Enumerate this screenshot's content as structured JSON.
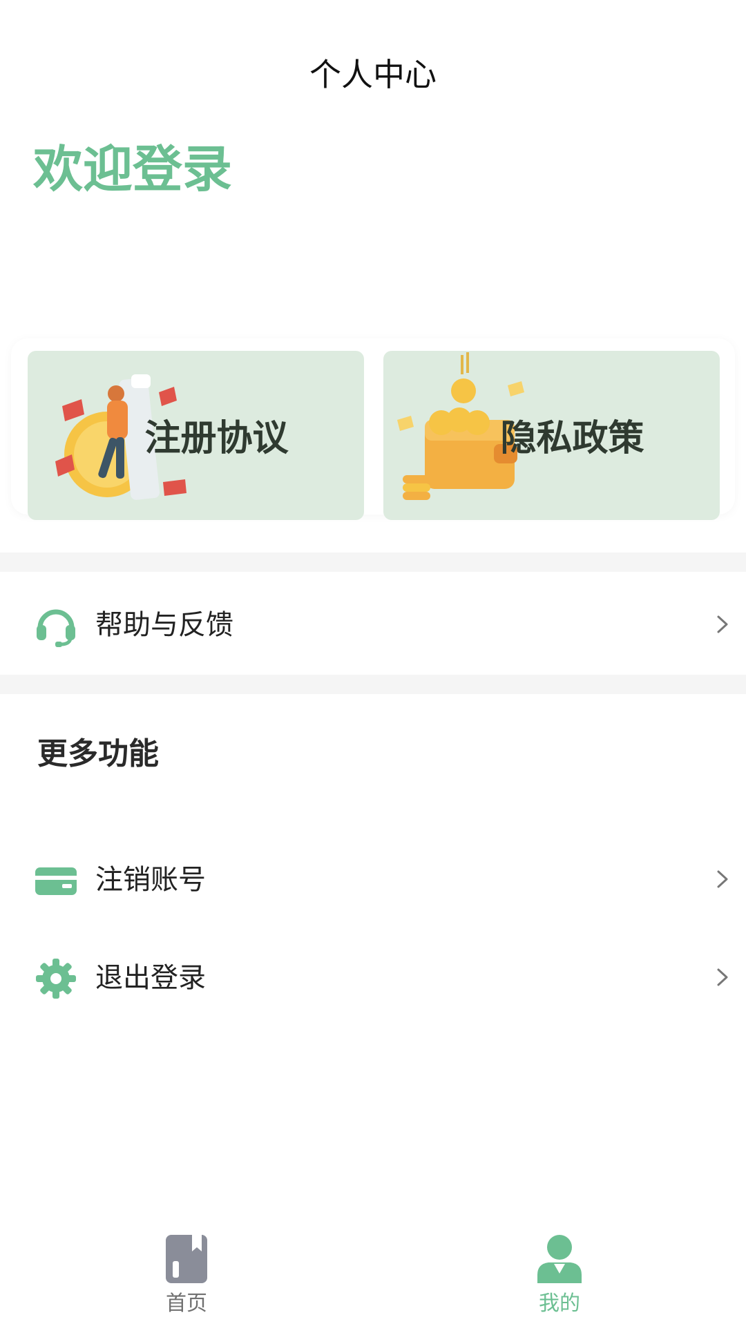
{
  "header": {
    "title": "个人中心"
  },
  "welcome": {
    "text": "欢迎登录"
  },
  "cards": [
    {
      "label": "注册协议"
    },
    {
      "label": "隐私政策"
    }
  ],
  "menu": {
    "help": {
      "label": "帮助与反馈"
    },
    "more_title": "更多功能",
    "cancel_account": {
      "label": "注销账号"
    },
    "logout": {
      "label": "退出登录"
    }
  },
  "tabbar": {
    "items": [
      {
        "label": "首页",
        "icon": "bookmark-book-icon",
        "active": false
      },
      {
        "label": "我的",
        "icon": "user-icon",
        "active": true
      }
    ]
  },
  "colors": {
    "accent": "#6cbf92",
    "card_bg": "#ddebdf",
    "divider": "#f5f5f5",
    "tab_inactive": "#8a8d99"
  }
}
